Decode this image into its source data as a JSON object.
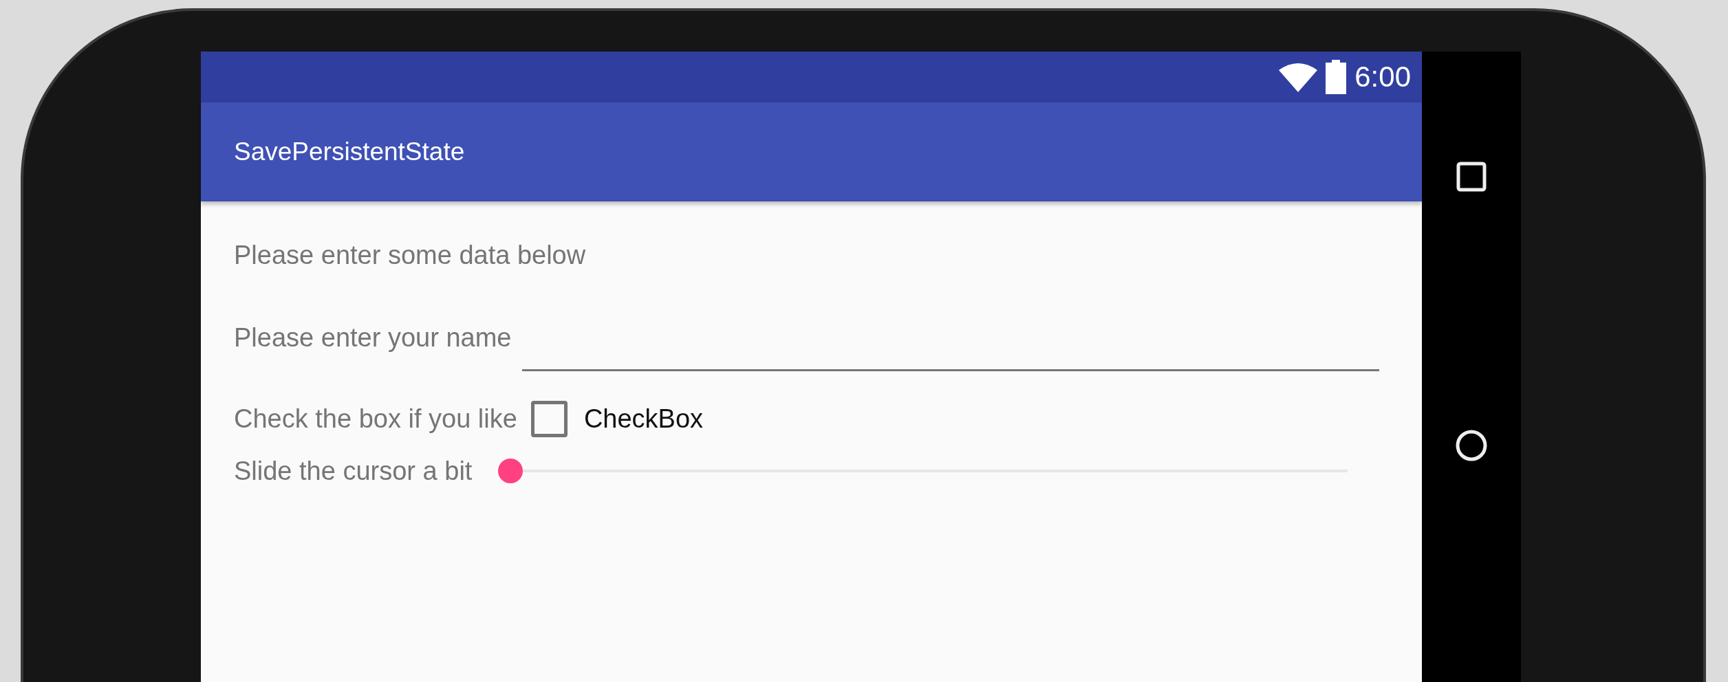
{
  "status_bar": {
    "time": "6:00"
  },
  "app_bar": {
    "title": "SavePersistentState"
  },
  "content": {
    "intro": "Please enter some data below",
    "name_field": {
      "label": "Please enter your name"
    },
    "checkbox": {
      "label": "Check the box if you like",
      "caption": "CheckBox",
      "checked": false
    },
    "slider": {
      "label": "Slide the cursor a bit",
      "level": 0
    }
  }
}
